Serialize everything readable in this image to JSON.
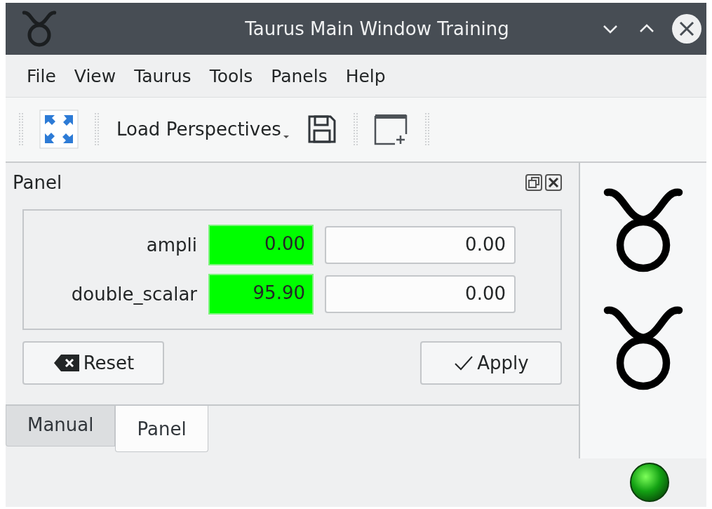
{
  "window": {
    "title": "Taurus Main Window Training"
  },
  "menu": [
    "File",
    "View",
    "Taurus",
    "Tools",
    "Panels",
    "Help"
  ],
  "toolbar": {
    "perspectives_button": "Load Perspectives"
  },
  "dock": {
    "title": "Panel",
    "rows": [
      {
        "label": "ampli",
        "reading": "0.00",
        "value": "0.00",
        "valid": true
      },
      {
        "label": "double_scalar",
        "reading": "95.90",
        "value": "0.00",
        "valid": true
      }
    ],
    "buttons": [
      {
        "label": "Reset",
        "kind": "reset"
      },
      {
        "label": "Apply",
        "kind": "apply"
      }
    ]
  },
  "tabs": [
    {
      "label": "Manual",
      "selected": false
    },
    {
      "label": "Panel",
      "selected": true
    }
  ],
  "status": {
    "led_on": true
  }
}
